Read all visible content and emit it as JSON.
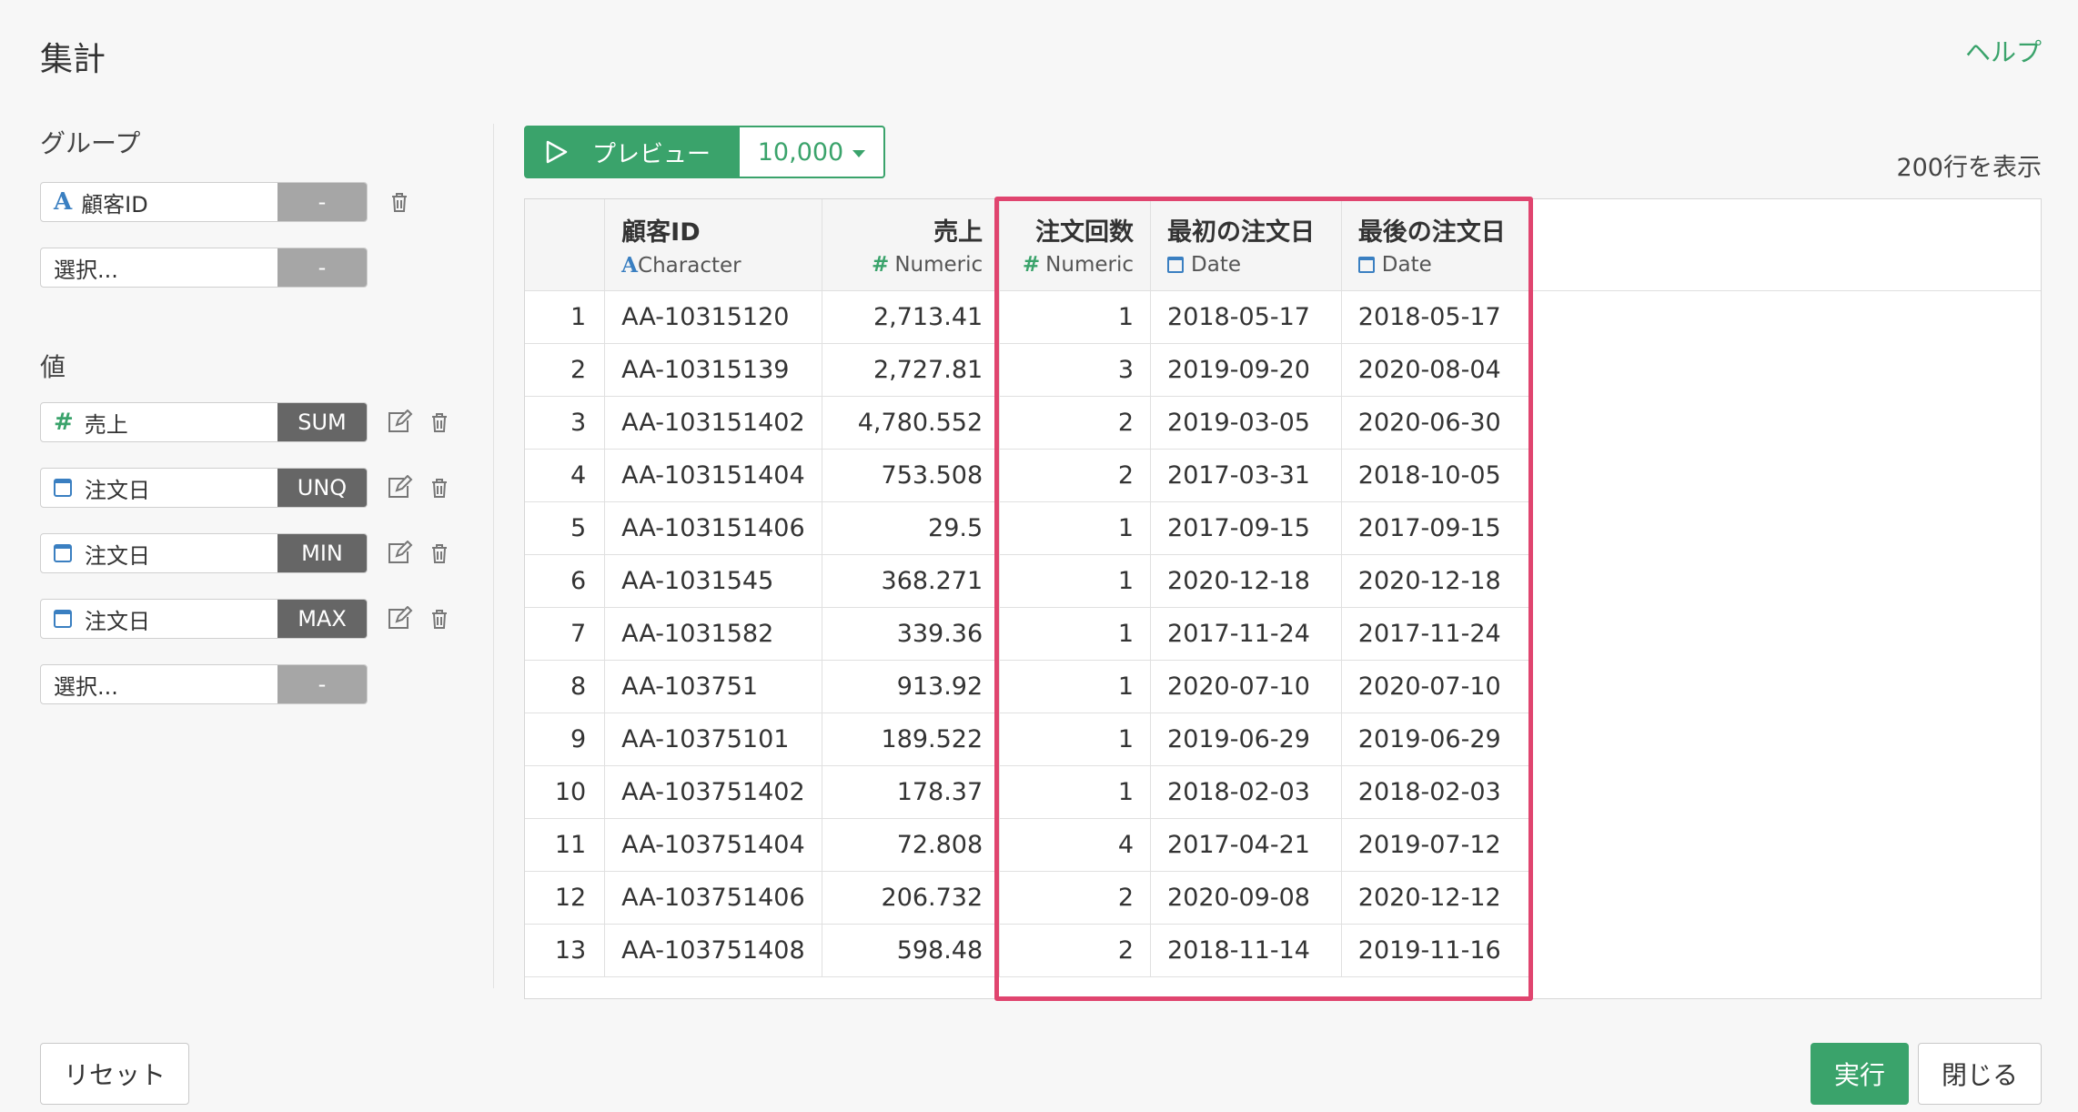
{
  "header": {
    "title": "集計",
    "help": "ヘルプ"
  },
  "group_section": {
    "label": "グループ",
    "items": [
      {
        "icon": "character-type-icon",
        "column": "顧客ID",
        "agg": "-"
      },
      {
        "column": "選択...",
        "agg": "-"
      }
    ]
  },
  "value_section": {
    "label": "値",
    "items": [
      {
        "icon": "numeric-type-icon",
        "column": "売上",
        "agg": "SUM"
      },
      {
        "icon": "date-type-icon",
        "column": "注文日",
        "agg": "UNQ"
      },
      {
        "icon": "date-type-icon",
        "column": "注文日",
        "agg": "MIN"
      },
      {
        "icon": "date-type-icon",
        "column": "注文日",
        "agg": "MAX"
      },
      {
        "column": "選択...",
        "agg": "-"
      }
    ]
  },
  "toolbar": {
    "preview_label": "プレビュー",
    "rows_value": "10,000",
    "row_count_text": "200行を表示"
  },
  "table": {
    "columns": [
      {
        "name": "顧客ID",
        "type": "Character"
      },
      {
        "name": "売上",
        "type": "Numeric"
      },
      {
        "name": "注文回数",
        "type": "Numeric"
      },
      {
        "name": "最初の注文日",
        "type": "Date"
      },
      {
        "name": "最後の注文日",
        "type": "Date"
      }
    ],
    "rows": [
      [
        "1",
        "AA-10315120",
        "2,713.41",
        "1",
        "2018-05-17",
        "2018-05-17"
      ],
      [
        "2",
        "AA-10315139",
        "2,727.81",
        "3",
        "2019-09-20",
        "2020-08-04"
      ],
      [
        "3",
        "AA-103151402",
        "4,780.552",
        "2",
        "2019-03-05",
        "2020-06-30"
      ],
      [
        "4",
        "AA-103151404",
        "753.508",
        "2",
        "2017-03-31",
        "2018-10-05"
      ],
      [
        "5",
        "AA-103151406",
        "29.5",
        "1",
        "2017-09-15",
        "2017-09-15"
      ],
      [
        "6",
        "AA-1031545",
        "368.271",
        "1",
        "2020-12-18",
        "2020-12-18"
      ],
      [
        "7",
        "AA-1031582",
        "339.36",
        "1",
        "2017-11-24",
        "2017-11-24"
      ],
      [
        "8",
        "AA-103751",
        "913.92",
        "1",
        "2020-07-10",
        "2020-07-10"
      ],
      [
        "9",
        "AA-10375101",
        "189.522",
        "1",
        "2019-06-29",
        "2019-06-29"
      ],
      [
        "10",
        "AA-103751402",
        "178.37",
        "1",
        "2018-02-03",
        "2018-02-03"
      ],
      [
        "11",
        "AA-103751404",
        "72.808",
        "4",
        "2017-04-21",
        "2019-07-12"
      ],
      [
        "12",
        "AA-103751406",
        "206.732",
        "2",
        "2020-09-08",
        "2020-12-12"
      ],
      [
        "13",
        "AA-103751408",
        "598.48",
        "2",
        "2018-11-14",
        "2019-11-16"
      ]
    ]
  },
  "footer": {
    "reset": "リセット",
    "run": "実行",
    "close": "閉じる"
  },
  "colors": {
    "accent": "#3aa36b",
    "highlight": "#e0456f",
    "type_blue": "#3a7fc1"
  }
}
